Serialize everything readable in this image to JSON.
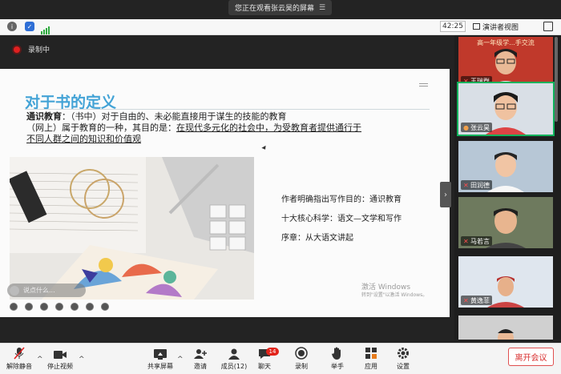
{
  "banner": {
    "text": "您正在观看张云昊的屏幕",
    "menu_icon": "menu-lines-icon"
  },
  "status": {
    "time": "42:25",
    "speaker_view_label": "演讲者视图",
    "icons": [
      "info-icon",
      "shield-icon",
      "signal-icon"
    ]
  },
  "recording": {
    "label": "录制中",
    "color": "#e02020"
  },
  "slide": {
    "title": "对于书的定义",
    "para1_label": "通识教育",
    "para1_text": "：（书中）对于自由的、未必能直接用于谋生的技能的教育",
    "para2_prefix": "（网上）属于教育的一种，其目的是：",
    "para2_underlined_1": "在现代多元化的社会中，为受教育者提供通行于",
    "para2_underlined_2": "不同人群之间的知识和价值观",
    "side_lines": [
      "作者明确指出写作目的：通识教育",
      "十大核心科学：语文—文学和写作",
      "序章：从大语文讲起"
    ],
    "watermark_title": "激活 Windows",
    "watermark_sub": "转到\"设置\"以激活 Windows。",
    "title_color": "#43a3d6"
  },
  "chat_bubble": {
    "text": "说点什么..."
  },
  "participants": [
    {
      "name": "王瑞群",
      "banner_text": "高一年级学...手交流",
      "muted": true
    },
    {
      "name": "张云昊",
      "muted": false,
      "active": true
    },
    {
      "name": "田润德",
      "muted": true
    },
    {
      "name": "马若言",
      "muted": true
    },
    {
      "name": "黄逸菲",
      "muted": true
    },
    {
      "name": "",
      "muted": true
    }
  ],
  "toolbar": {
    "mute_label": "解除静音",
    "video_label": "停止视频",
    "share_label": "共享屏幕",
    "invite_label": "邀请",
    "members_label": "成员(12)",
    "chat_label": "聊天",
    "chat_badge": "14",
    "record_label": "录制",
    "raise_hand_label": "举手",
    "apps_label": "应用",
    "settings_label": "设置",
    "leave_label": "离开会议"
  }
}
